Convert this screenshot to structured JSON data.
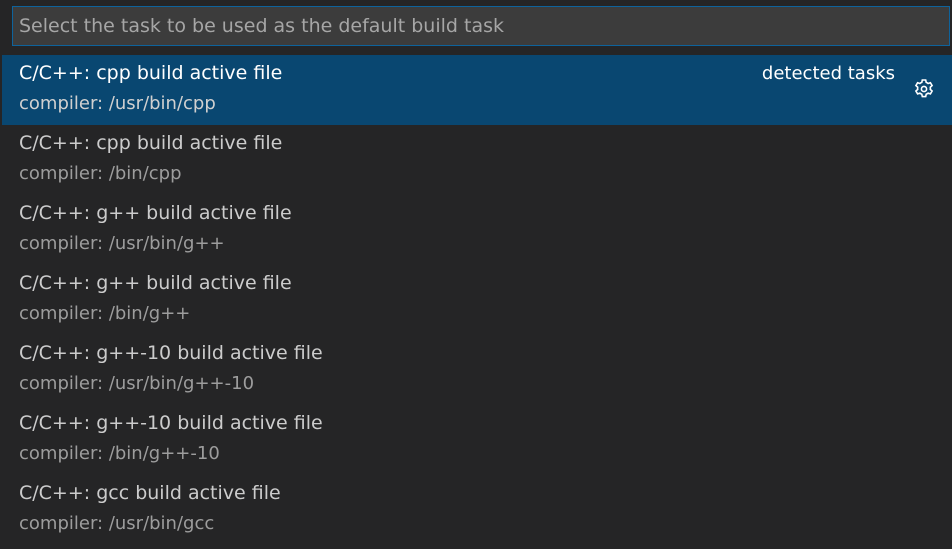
{
  "search": {
    "placeholder": "Select the task to be used as the default build task",
    "value": ""
  },
  "tasks": [
    {
      "label": "C/C++: cpp build active file",
      "detail": "compiler: /usr/bin/cpp",
      "tag": "detected tasks",
      "selected": true
    },
    {
      "label": "C/C++: cpp build active file",
      "detail": "compiler: /bin/cpp"
    },
    {
      "label": "C/C++: g++ build active file",
      "detail": "compiler: /usr/bin/g++"
    },
    {
      "label": "C/C++: g++ build active file",
      "detail": "compiler: /bin/g++"
    },
    {
      "label": "C/C++: g++-10 build active file",
      "detail": "compiler: /usr/bin/g++-10"
    },
    {
      "label": "C/C++: g++-10 build active file",
      "detail": "compiler: /bin/g++-10"
    },
    {
      "label": "C/C++: gcc build active file",
      "detail": "compiler: /usr/bin/gcc"
    }
  ],
  "icons": {
    "configure": "gear-icon"
  },
  "colors": {
    "background": "#252526",
    "selection": "#094771",
    "input_border": "#0e639c"
  }
}
